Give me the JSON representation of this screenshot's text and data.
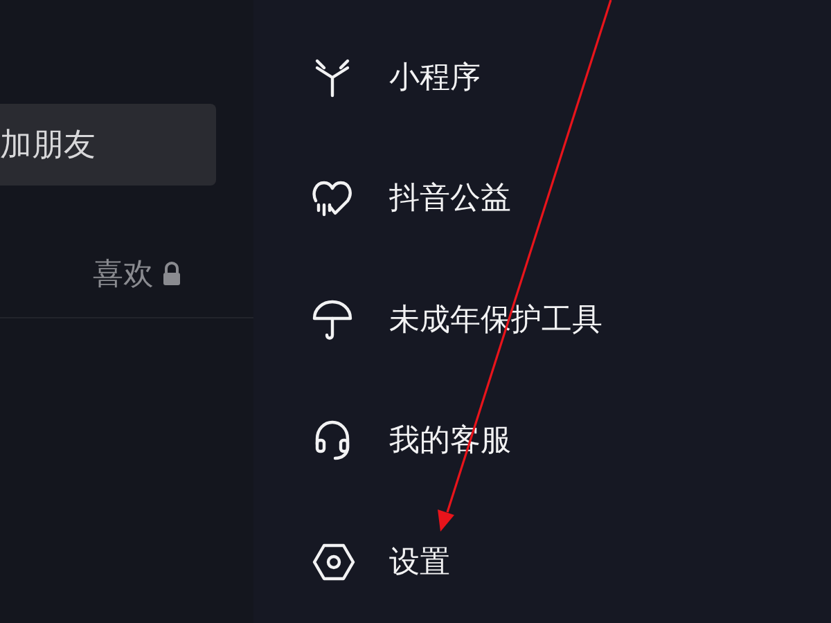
{
  "left_panel": {
    "button": "加朋友",
    "tab": {
      "label": "喜欢",
      "locked": true
    }
  },
  "drawer": {
    "items": [
      {
        "kind": "sparkle",
        "label": "小程序"
      },
      {
        "kind": "heart",
        "label": "抖音公益"
      },
      {
        "kind": "umbrella",
        "label": "未成年保护工具"
      },
      {
        "kind": "headset",
        "label": "我的客服"
      },
      {
        "kind": "settings",
        "label": "设置"
      }
    ]
  }
}
